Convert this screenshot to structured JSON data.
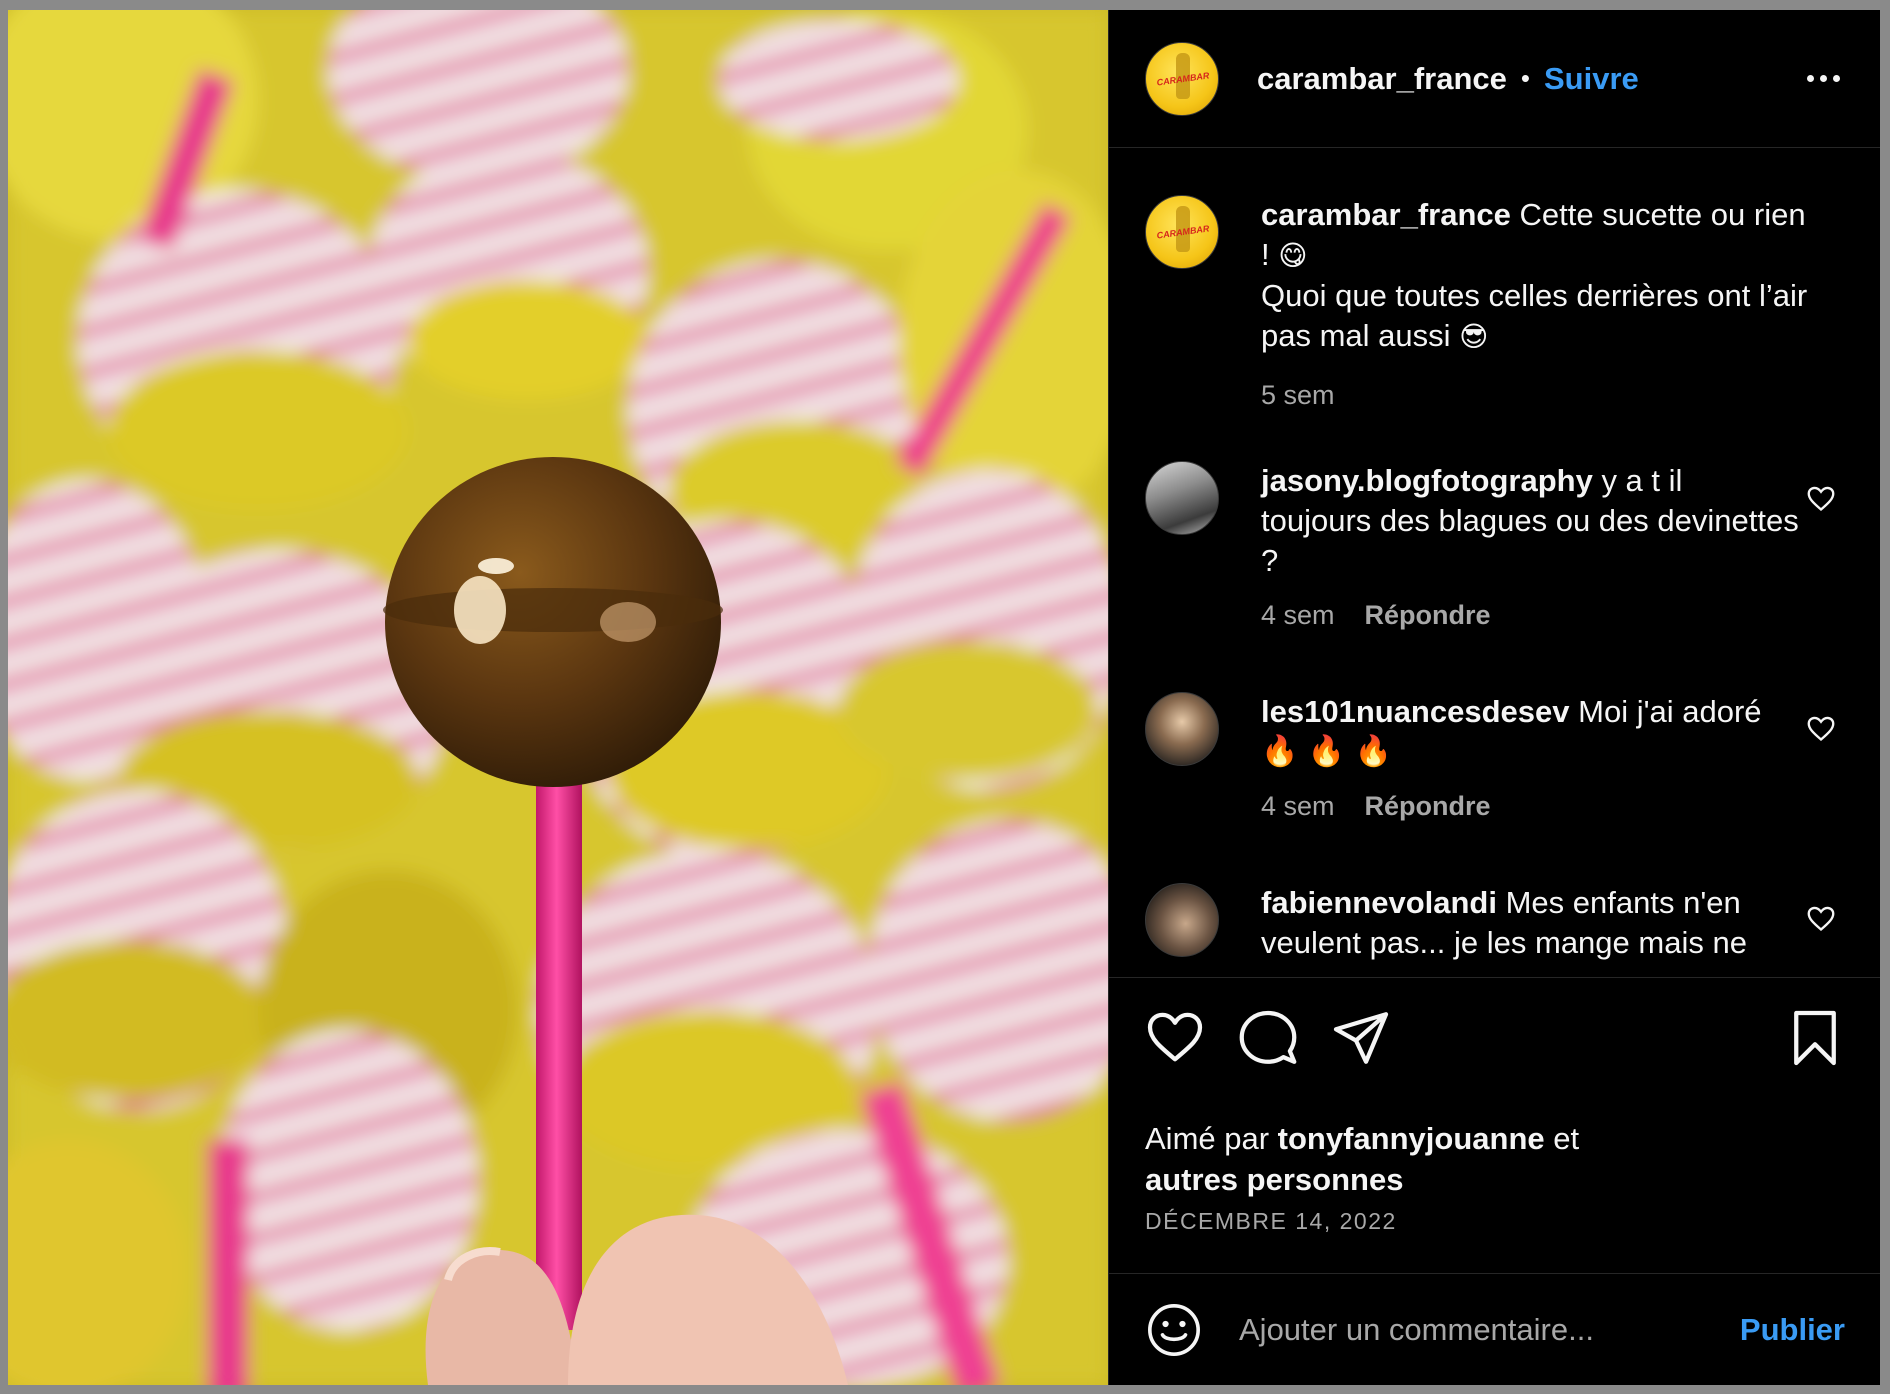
{
  "post": {
    "username": "carambar_france",
    "separator": "•",
    "follow_label": "Suivre",
    "more_icon": "more-horizontal-icon"
  },
  "caption": {
    "username": "carambar_france",
    "line1": "Cette sucette ou rien !",
    "emoji1": "😋",
    "line2": "Quoi que toutes celles derrières ont l’air pas mal aussi",
    "emoji2": "😎",
    "time": "5 sem"
  },
  "comments": [
    {
      "username": "jasony.blogfotography",
      "text": "y a t il toujours des blagues ou des devinettes ?",
      "time": "4 sem",
      "reply_label": "Répondre"
    },
    {
      "username": "les101nuancesdesev",
      "text": "Moi j'ai adoré",
      "emojis": "🔥 🔥 🔥",
      "time": "4 sem",
      "reply_label": "Répondre"
    },
    {
      "username": "fabiennevolandi",
      "text": "Mes enfants n'en veulent pas... je les mange mais ne"
    }
  ],
  "actions": {
    "icons": [
      "heart-icon",
      "comment-icon",
      "share-icon",
      "bookmark-icon"
    ]
  },
  "likes": {
    "prefix": "Aimé par",
    "user": "tonyfannyjouanne",
    "middle": "et",
    "others": "autres personnes"
  },
  "date": "DÉCEMBRE 14, 2022",
  "add_comment": {
    "placeholder": "Ajouter un commentaire...",
    "publish_label": "Publier"
  },
  "avatar_logo_text": "CARAMBAR",
  "colors": {
    "background": "#000000",
    "accent_link": "#3a9bf4",
    "muted_text": "#a8a8a8",
    "divider": "#262626"
  }
}
